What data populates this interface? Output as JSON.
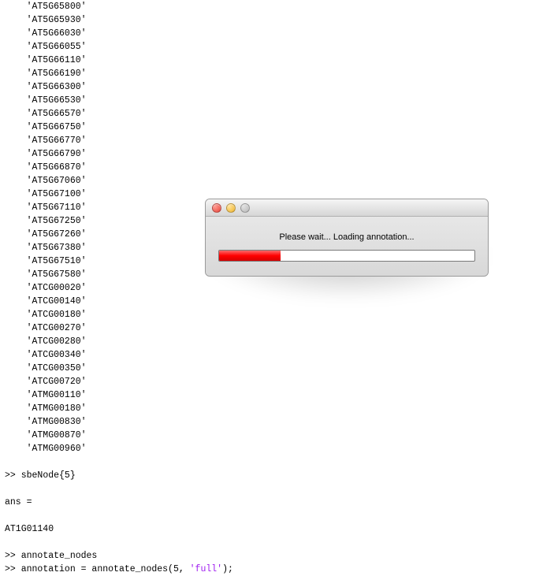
{
  "terminal": {
    "gene_list": [
      "'AT5G65800'",
      "'AT5G65930'",
      "'AT5G66030'",
      "'AT5G66055'",
      "'AT5G66110'",
      "'AT5G66190'",
      "'AT5G66300'",
      "'AT5G66530'",
      "'AT5G66570'",
      "'AT5G66750'",
      "'AT5G66770'",
      "'AT5G66790'",
      "'AT5G66870'",
      "'AT5G67060'",
      "'AT5G67100'",
      "'AT5G67110'",
      "'AT5G67250'",
      "'AT5G67260'",
      "'AT5G67380'",
      "'AT5G67510'",
      "'AT5G67580'",
      "'ATCG00020'",
      "'ATCG00140'",
      "'ATCG00180'",
      "'ATCG00270'",
      "'ATCG00280'",
      "'ATCG00340'",
      "'ATCG00350'",
      "'ATCG00720'",
      "'ATMG00110'",
      "'ATMG00180'",
      "'ATMG00830'",
      "'ATMG00870'",
      "'ATMG00960'"
    ],
    "prompt1_pre": ">> ",
    "prompt1_cmd": "sbeNode{5}",
    "ans_label": "ans =",
    "ans_value": "AT1G01140",
    "prompt2_pre": ">> ",
    "prompt2_cmd": "annotate_nodes",
    "prompt3_pre": ">> ",
    "prompt3_a": "annotation = annotate_nodes(5, ",
    "prompt3_str": "'full'",
    "prompt3_b": ");"
  },
  "dialog": {
    "message": "Please wait... Loading annotation...",
    "progress_percent": 24,
    "buttons": {
      "close": "Close",
      "minimize": "Minimize",
      "zoom": "Zoom"
    }
  }
}
